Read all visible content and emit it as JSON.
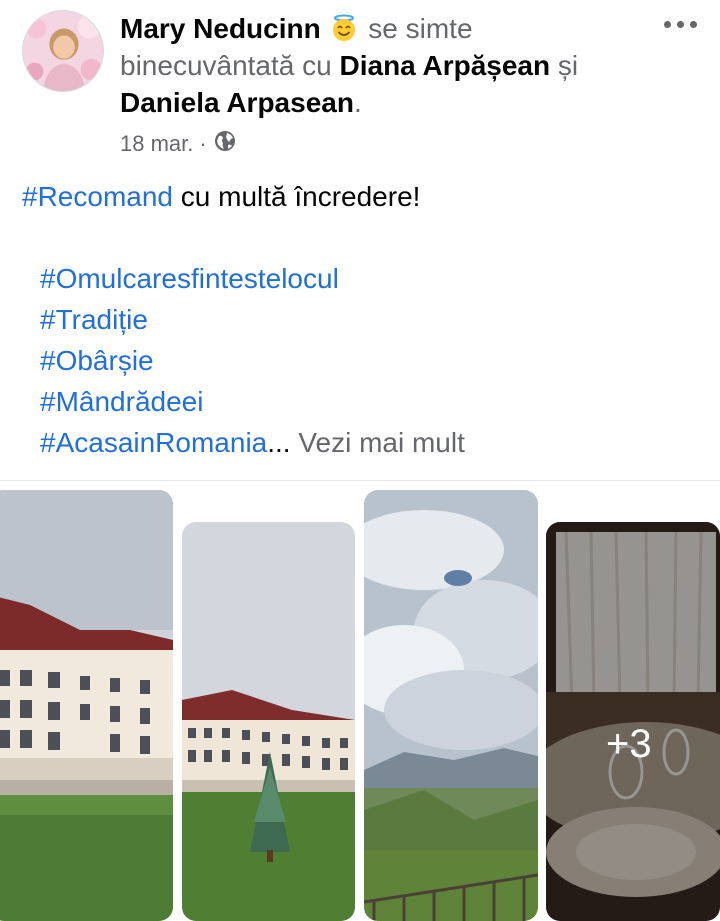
{
  "author": {
    "name": "Mary Neducinn",
    "feeling_text": "se simte",
    "feeling": "binecuvântată",
    "with_text": "cu",
    "tagged1": "Diana Arpășean",
    "and_text": "și",
    "tagged2": "Daniela Arpasean",
    "period": "."
  },
  "meta": {
    "date": "18 mar.",
    "separator": "·"
  },
  "post": {
    "line1_tag": "#Recomand",
    "line1_text": " cu multă încredere!",
    "tags": [
      "#Omulcaresfintestelocul",
      "#Tradiție",
      "#Obârșie",
      "#Mândrădeei"
    ],
    "last_tag": "#AcasainRomania",
    "ellipsis": "...",
    "see_more": " Vezi mai mult"
  },
  "photos": {
    "extra_count": "+3"
  },
  "colors": {
    "link": "#216fdb",
    "meta": "#65676b",
    "text": "#050505"
  },
  "icons": {
    "feeling": "halo-smile-emoji-icon",
    "audience": "globe-icon",
    "menu": "more-options-icon"
  }
}
